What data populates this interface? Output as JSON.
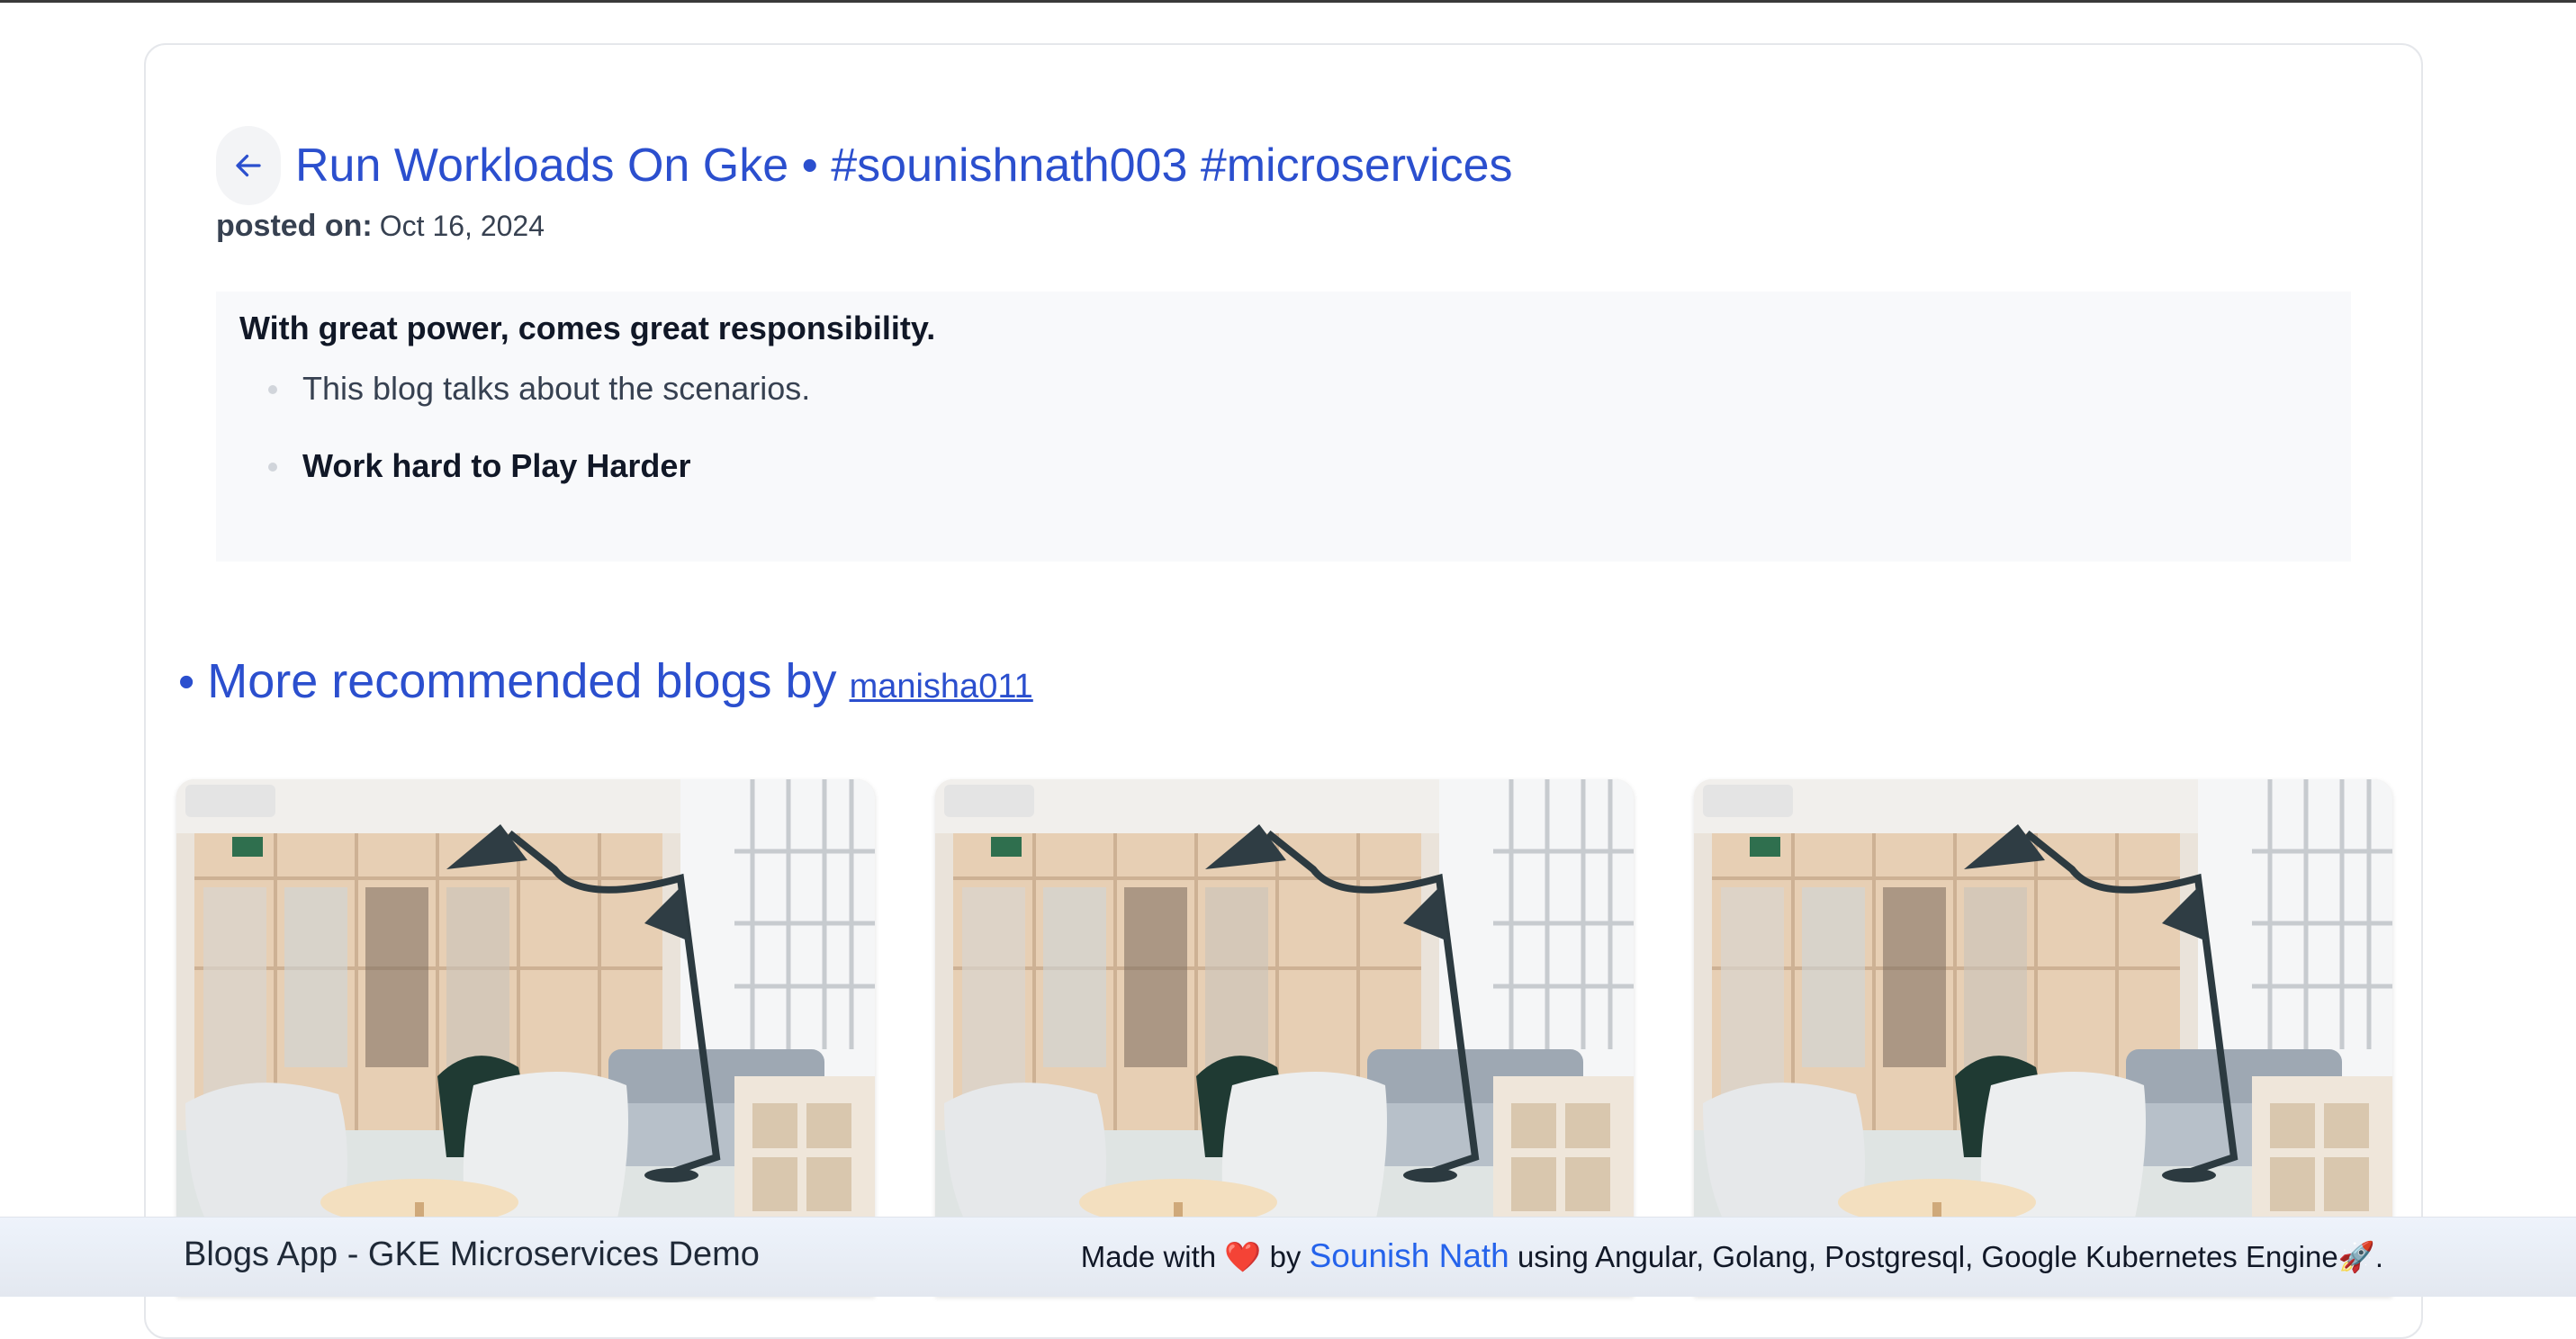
{
  "post": {
    "title": "Run Workloads On Gke • #sounishnath003 #microservices",
    "posted_label": "posted on:",
    "posted_date": "Oct 16, 2024",
    "lead": "With great power, comes great responsibility.",
    "bullets": [
      "This blog talks about the scenarios.",
      "Work hard to Play Harder"
    ]
  },
  "recommended": {
    "bullet": "•",
    "heading": "More recommended blogs by",
    "author": "manisha011",
    "cards": [
      {
        "image": "office-interior-photo"
      },
      {
        "image": "office-interior-photo"
      },
      {
        "image": "office-interior-photo"
      }
    ]
  },
  "footer": {
    "app_name": "Blogs App - GKE Microservices Demo",
    "made_with": "Made with",
    "heart": "❤️",
    "by": "by",
    "author": "Sounish Nath",
    "using": "using Angular, Golang, Postgresql, Google Kubernetes Engine",
    "rocket": "🚀",
    "period": "."
  },
  "colors": {
    "accent": "#2b4fce",
    "link": "#2563eb",
    "panel": "#f8f9fb"
  }
}
